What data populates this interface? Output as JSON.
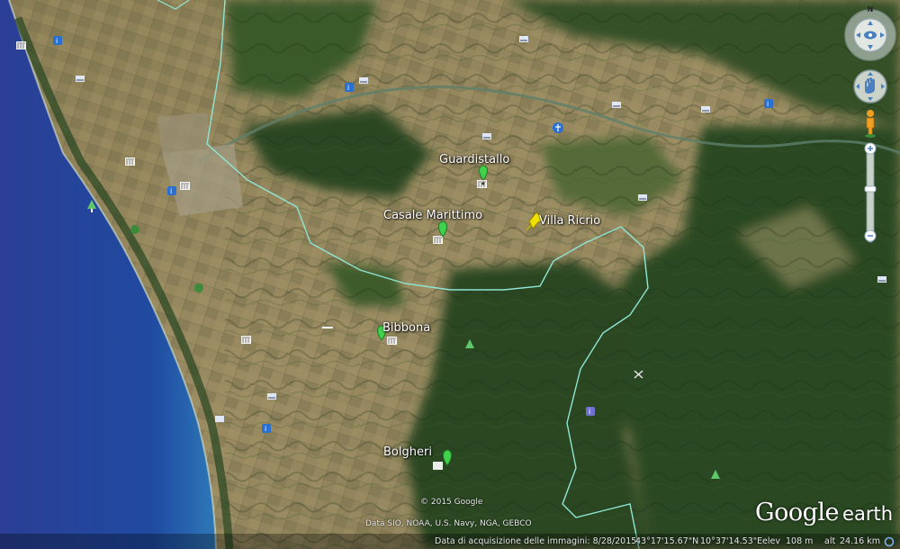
{
  "places": [
    {
      "id": "guardistallo",
      "label": "Guardistallo",
      "pin": "green"
    },
    {
      "id": "casale-marittimo",
      "label": "Casale Marittimo",
      "pin": "green"
    },
    {
      "id": "villa-ricrio",
      "label": "Villa Ricrio",
      "pin": "yellow-pushpin"
    },
    {
      "id": "bibbona",
      "label": "Bibbona",
      "pin": "green"
    },
    {
      "id": "bolgheri",
      "label": "Bolgheri",
      "pin": "green"
    }
  ],
  "copyright": {
    "google": "© 2015 Google",
    "data": "Data SIO, NOAA, U.S. Navy, NGA, GEBCO"
  },
  "status": {
    "imagery_date": "Data di acquisizione delle immagini: 8/28/2015",
    "lat": "43°17'15.67\"N",
    "lon": "10°37'14.53\"E",
    "elev_label": "elev",
    "elev_value": "108 m",
    "alt_label": "alt",
    "alt_value": "24.16 km"
  },
  "brand": {
    "google": "Google",
    "earth": "earth"
  },
  "nav": {
    "north_label": "N"
  },
  "colors": {
    "sea": "#1d3f8a",
    "farmland": "#8c7f58",
    "forest": "#2d4a22",
    "border": "#8fe6d4",
    "pin_green": "#3fd24a",
    "pin_yellow": "#f0e000"
  },
  "icons": [
    "hotel-icon",
    "museum-icon",
    "info-icon",
    "park-icon",
    "church-icon",
    "restaurant-icon"
  ]
}
